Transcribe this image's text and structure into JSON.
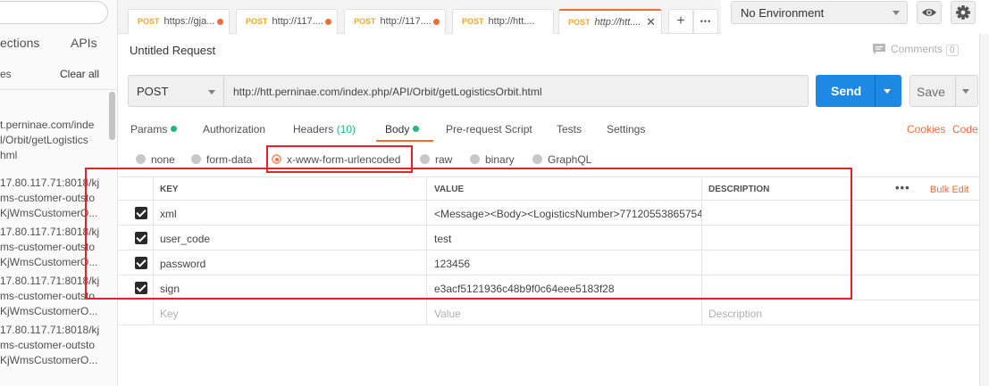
{
  "sidebar": {
    "tabs": [
      "ections",
      "APIs"
    ],
    "history_label": "es",
    "clear_all": "Clear all",
    "items": [
      "t.perninae.com/inde\nl/Orbit/getLogistics\nhml",
      "17.80.117.71:8018/kj\nms-customer-outsto\nKjWmsCustomerO...",
      "17.80.117.71:8018/kj\nms-customer-outsto\nKjWmsCustomerO...",
      "17.80.117.71:8018/kj\nms-customer-outsto\nKjWmsCustomerO...",
      "17.80.117.71:8018/kj\nms-customer-outsto\nKjWmsCustomerO..."
    ]
  },
  "tabs": [
    {
      "method": "POST",
      "url": "https://gja...",
      "unsaved": true
    },
    {
      "method": "POST",
      "url": "http://117....",
      "unsaved": true
    },
    {
      "method": "POST",
      "url": "http://117....",
      "unsaved": true
    },
    {
      "method": "POST",
      "url": "http://htt....",
      "unsaved": false
    },
    {
      "method": "POST",
      "url": "http://htt....",
      "unsaved": false,
      "active": true
    }
  ],
  "tabbar": {
    "add_icon": "+",
    "more_icon": "•••"
  },
  "environment": {
    "selected": "No Environment"
  },
  "request": {
    "title": "Untitled Request",
    "comments_label": "Comments",
    "comments_count": "0",
    "method": "POST",
    "url": "http://htt.perninae.com/index.php/API/Orbit/getLogisticsOrbit.html",
    "send_label": "Send",
    "save_label": "Save"
  },
  "subtabs": {
    "params": "Params",
    "authorization": "Authorization",
    "headers": "Headers",
    "headers_count": "(10)",
    "body": "Body",
    "prerequest": "Pre-request Script",
    "tests": "Tests",
    "settings": "Settings",
    "cookies": "Cookies",
    "code": "Code"
  },
  "body_types": [
    "none",
    "form-data",
    "x-www-form-urlencoded",
    "raw",
    "binary",
    "GraphQL"
  ],
  "body_type_selected": "x-www-form-urlencoded",
  "table": {
    "headers": {
      "key": "KEY",
      "value": "VALUE",
      "description": "DESCRIPTION"
    },
    "bulk_edit": "Bulk Edit",
    "more_icon": "•••",
    "rows": [
      {
        "key": "xml",
        "value": "<Message><Body><LogisticsNumber>77120553865754",
        "description": ""
      },
      {
        "key": "user_code",
        "value": "test",
        "description": ""
      },
      {
        "key": "password",
        "value": "123456",
        "description": ""
      },
      {
        "key": "sign",
        "value": "e3acf5121936c48b9f0c64eee5183f28",
        "description": ""
      }
    ],
    "placeholder": {
      "key": "Key",
      "value": "Value",
      "description": "Description"
    }
  }
}
